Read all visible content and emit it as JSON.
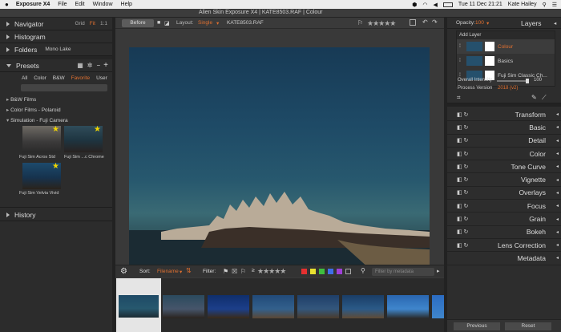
{
  "menubar": {
    "apple": "",
    "app": "Exposure X4",
    "items": [
      "File",
      "Edit",
      "Window",
      "Help"
    ],
    "datetime": "Tue 11 Dec  21:21",
    "user": "Kate Hailey"
  },
  "window": {
    "title": "Alien Skin Exposure X4 | KATE8503.RAF | Colour"
  },
  "left": {
    "navigator": "Navigator",
    "grid": "Grid",
    "fit": "Fit",
    "one_to_one": "1:1",
    "histogram": "Histogram",
    "folders": "Folders",
    "folder_name": "Mono Lake",
    "presets": "Presets",
    "tabs": [
      "All",
      "Color",
      "B&W",
      "Favorite",
      "User"
    ],
    "groups": [
      "B&W Films",
      "Color Films - Polaroid",
      "Simulation - Fuji Camera"
    ],
    "thumbs": [
      "Fuji Sim Acros Std",
      "Fuji Sim ...c Chrome",
      "Fuji Sim Velvia Vivid"
    ],
    "history": "History"
  },
  "toolbar": {
    "before": "Before",
    "layout_label": "Layout:",
    "layout_value": "Single",
    "filename": "KATE8503.RAF"
  },
  "filmstrip_bar": {
    "sort_label": "Sort:",
    "sort_value": "Filename",
    "filter_label": "Filter:",
    "filter_placeholder": "Filter by metadata",
    "rating_prefix": "≥",
    "color_filters": [
      "#e53030",
      "#e8e030",
      "#3fbf3f",
      "#3f6fe8",
      "#a040d8"
    ]
  },
  "right": {
    "opacity_label": "Opacity:",
    "opacity_value": "100",
    "layers": "Layers",
    "add_layer": "Add Layer",
    "layer_items": [
      "Colour",
      "Basics",
      "Fuji Sim Classic Ch..."
    ],
    "overall_intensity_label": "Overall Intensity",
    "overall_intensity_value": "100",
    "process_version_label": "Process Version",
    "process_version_value": "2018 (v2)",
    "panels": [
      "Transform",
      "Basic",
      "Detail",
      "Color",
      "Tone Curve",
      "Vignette",
      "Overlays",
      "Focus",
      "Grain",
      "Bokeh",
      "Lens Correction",
      "Metadata"
    ],
    "previous": "Previous",
    "reset": "Reset"
  }
}
